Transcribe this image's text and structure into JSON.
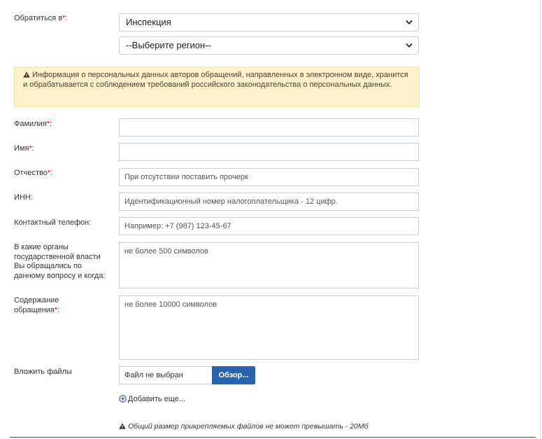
{
  "form": {
    "recipient": {
      "label": "Обратиться в",
      "required_mark": "*:",
      "value": "Инспекция"
    },
    "region": {
      "value": "--Выберите регион--"
    },
    "notice": {
      "text": "Информация о персональных данных авторов обращений, направленных в электронном виде, хранится и обрабатывается с соблюдением требований российского законодательства о персональных данных."
    },
    "last_name": {
      "label": "Фамилия",
      "required_mark": "*:",
      "value": ""
    },
    "first_name": {
      "label": "Имя",
      "required_mark": "*:",
      "value": ""
    },
    "patronymic": {
      "label": "Отчество",
      "required_mark": "*:",
      "placeholder": "При отсутствии поставить прочерк"
    },
    "inn": {
      "label": "ИНН:",
      "placeholder": "Идентификационный номер налогоплательщика - 12 цифр."
    },
    "phone": {
      "label": "Контактный телефон:",
      "placeholder": "Например: +7 (987) 123-45-67"
    },
    "prior_agencies": {
      "label": "В какие органы государственной власти Вы обращались по данному вопросу и когда:",
      "placeholder": "не более 500 символов"
    },
    "content": {
      "label": "Содержание обращения",
      "required_mark": "*:",
      "placeholder": "не более 10000 символов"
    },
    "attachments": {
      "label": "Вложить файлы",
      "file_status": "Файл не выбран",
      "browse_label": "Обзор...",
      "add_more_label": "Добавить еще...",
      "size_note": "Общий размер прикрепляемых файлов не может превышать - 20Мб"
    }
  },
  "colors": {
    "accent": "#2a63ad",
    "required": "#d9001b",
    "notice_bg": "#fcf1c9",
    "border": "#c8d2d8"
  },
  "icons": {
    "select_arrow": "chevron-down-icon",
    "notice": "warning-icon",
    "add_more": "plus-circle-icon",
    "size_note": "warning-icon"
  }
}
